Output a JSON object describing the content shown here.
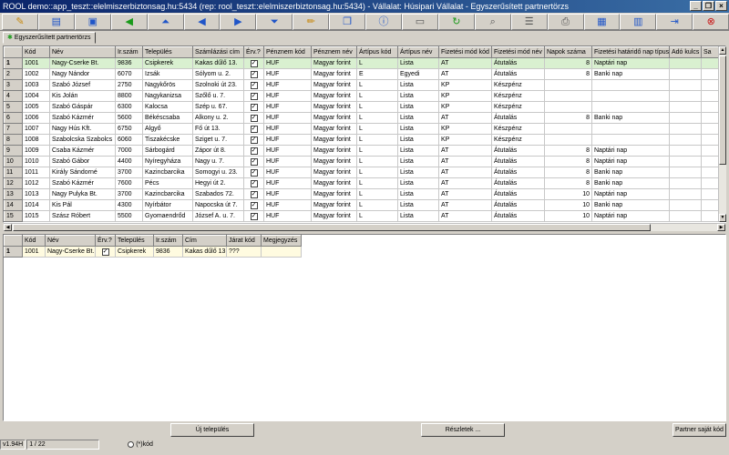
{
  "window": {
    "title": "ROOL demo::app_teszt::elelmiszerbiztonsag.hu:5434 (rep: rool_teszt::elelmiszerbiztonsag.hu:5434) - Vállalat: Húsipari Vállalat - Egyszerűsített partnertörzs",
    "min_label": "_",
    "max_label": "❐",
    "close_label": "×"
  },
  "tab": {
    "label": "Egyszerűsített partnertörzs"
  },
  "top_grid": {
    "columns": [
      "Kód",
      "Név",
      "Ir.szám",
      "Település",
      "Számlázási cím",
      "Érv.?",
      "Pénznem kód",
      "Pénznem név",
      "Ártípus kód",
      "Ártípus név",
      "Fizetési mód kód",
      "Fizetési mód név",
      "Napok száma",
      "Fizetési határidő nap típus",
      "Adó kulcs",
      "Sa"
    ],
    "rows": [
      {
        "rn": "1",
        "kod": "1001",
        "nev": "Nagy-Cserke Bt.",
        "irsz": "9836",
        "telep": "Csipkerek",
        "cim": "Kakas dűlő 13.",
        "erv": "✓",
        "pk": "HUF",
        "pn": "Magyar forint",
        "ak": "L",
        "an": "Lista",
        "fk": "AT",
        "fn": "Átutalás",
        "nap": "8",
        "tip": "Naptári nap",
        "ado": "",
        "sa": ""
      },
      {
        "rn": "2",
        "kod": "1002",
        "nev": "Nagy Nándor",
        "irsz": "6070",
        "telep": "Izsák",
        "cim": "Sólyom u. 2.",
        "erv": "✓",
        "pk": "HUF",
        "pn": "Magyar forint",
        "ak": "E",
        "an": "Egyedi",
        "fk": "AT",
        "fn": "Átutalás",
        "nap": "8",
        "tip": "Banki nap",
        "ado": "",
        "sa": ""
      },
      {
        "rn": "3",
        "kod": "1003",
        "nev": "Szabó József",
        "irsz": "2750",
        "telep": "Nagykőrös",
        "cim": "Szolnoki út 23.",
        "erv": "✓",
        "pk": "HUF",
        "pn": "Magyar forint",
        "ak": "L",
        "an": "Lista",
        "fk": "KP",
        "fn": "Készpénz",
        "nap": "",
        "tip": "",
        "ado": "",
        "sa": ""
      },
      {
        "rn": "4",
        "kod": "1004",
        "nev": "Kis Jolán",
        "irsz": "8800",
        "telep": "Nagykanizsa",
        "cim": "Szőlő u. 7.",
        "erv": "✓",
        "pk": "HUF",
        "pn": "Magyar forint",
        "ak": "L",
        "an": "Lista",
        "fk": "KP",
        "fn": "Készpénz",
        "nap": "",
        "tip": "",
        "ado": "",
        "sa": ""
      },
      {
        "rn": "5",
        "kod": "1005",
        "nev": "Szabó Gáspár",
        "irsz": "6300",
        "telep": "Kalocsa",
        "cim": "Szép u. 67.",
        "erv": "✓",
        "pk": "HUF",
        "pn": "Magyar forint",
        "ak": "L",
        "an": "Lista",
        "fk": "KP",
        "fn": "Készpénz",
        "nap": "",
        "tip": "",
        "ado": "",
        "sa": ""
      },
      {
        "rn": "6",
        "kod": "1006",
        "nev": "Szabó Kázmér",
        "irsz": "5600",
        "telep": "Békéscsaba",
        "cim": "Alkony u. 2.",
        "erv": "✓",
        "pk": "HUF",
        "pn": "Magyar forint",
        "ak": "L",
        "an": "Lista",
        "fk": "AT",
        "fn": "Átutalás",
        "nap": "8",
        "tip": "Banki nap",
        "ado": "",
        "sa": ""
      },
      {
        "rn": "7",
        "kod": "1007",
        "nev": "Nagy Hús Kft.",
        "irsz": "6750",
        "telep": "Algyő",
        "cim": "Fő út 13.",
        "erv": "✓",
        "pk": "HUF",
        "pn": "Magyar forint",
        "ak": "L",
        "an": "Lista",
        "fk": "KP",
        "fn": "Készpénz",
        "nap": "",
        "tip": "",
        "ado": "",
        "sa": ""
      },
      {
        "rn": "8",
        "kod": "1008",
        "nev": "Szabolcska Szabolcs",
        "irsz": "6060",
        "telep": "Tiszakécske",
        "cim": "Sziget u. 7.",
        "erv": "✓",
        "pk": "HUF",
        "pn": "Magyar forint",
        "ak": "L",
        "an": "Lista",
        "fk": "KP",
        "fn": "Készpénz",
        "nap": "",
        "tip": "",
        "ado": "",
        "sa": ""
      },
      {
        "rn": "9",
        "kod": "1009",
        "nev": "Csaba Kázmér",
        "irsz": "7000",
        "telep": "Sárbogárd",
        "cim": "Zápor út 8.",
        "erv": "✓",
        "pk": "HUF",
        "pn": "Magyar forint",
        "ak": "L",
        "an": "Lista",
        "fk": "AT",
        "fn": "Átutalás",
        "nap": "8",
        "tip": "Naptári nap",
        "ado": "",
        "sa": ""
      },
      {
        "rn": "10",
        "kod": "1010",
        "nev": "Szabó Gábor",
        "irsz": "4400",
        "telep": "Nyíregyháza",
        "cim": "Nagy u. 7.",
        "erv": "✓",
        "pk": "HUF",
        "pn": "Magyar forint",
        "ak": "L",
        "an": "Lista",
        "fk": "AT",
        "fn": "Átutalás",
        "nap": "8",
        "tip": "Naptári nap",
        "ado": "",
        "sa": ""
      },
      {
        "rn": "11",
        "kod": "1011",
        "nev": "Király Sándorné",
        "irsz": "3700",
        "telep": "Kazincbarcika",
        "cim": "Somogyi u. 23.",
        "erv": "✓",
        "pk": "HUF",
        "pn": "Magyar forint",
        "ak": "L",
        "an": "Lista",
        "fk": "AT",
        "fn": "Átutalás",
        "nap": "8",
        "tip": "Banki nap",
        "ado": "",
        "sa": ""
      },
      {
        "rn": "12",
        "kod": "1012",
        "nev": "Szabó Kázmér",
        "irsz": "7600",
        "telep": "Pécs",
        "cim": "Hegyi út 2.",
        "erv": "✓",
        "pk": "HUF",
        "pn": "Magyar forint",
        "ak": "L",
        "an": "Lista",
        "fk": "AT",
        "fn": "Átutalás",
        "nap": "8",
        "tip": "Banki nap",
        "ado": "",
        "sa": ""
      },
      {
        "rn": "13",
        "kod": "1013",
        "nev": "Nagy Pulyka Bt.",
        "irsz": "3700",
        "telep": "Kazincbarcika",
        "cim": "Szabados 72.",
        "erv": "✓",
        "pk": "HUF",
        "pn": "Magyar forint",
        "ak": "L",
        "an": "Lista",
        "fk": "AT",
        "fn": "Átutalás",
        "nap": "10",
        "tip": "Naptári nap",
        "ado": "",
        "sa": ""
      },
      {
        "rn": "14",
        "kod": "1014",
        "nev": "Kis Pál",
        "irsz": "4300",
        "telep": "Nyírbátor",
        "cim": "Napocska út 7.",
        "erv": "✓",
        "pk": "HUF",
        "pn": "Magyar forint",
        "ak": "L",
        "an": "Lista",
        "fk": "AT",
        "fn": "Átutalás",
        "nap": "10",
        "tip": "Banki nap",
        "ado": "",
        "sa": ""
      },
      {
        "rn": "15",
        "kod": "1015",
        "nev": "Szász Róbert",
        "irsz": "5500",
        "telep": "Gyomaendrőd",
        "cim": "József A. u. 7.",
        "erv": "✓",
        "pk": "HUF",
        "pn": "Magyar forint",
        "ak": "L",
        "an": "Lista",
        "fk": "AT",
        "fn": "Átutalás",
        "nap": "10",
        "tip": "Naptári nap",
        "ado": "",
        "sa": ""
      }
    ]
  },
  "bottom_grid": {
    "columns": [
      "Kód",
      "Név",
      "Érv.?",
      "Település",
      "Ir.szám",
      "Cím",
      "Járat kód",
      "Megjegyzés"
    ],
    "rows": [
      {
        "rn": "1",
        "kod": "1001",
        "nev": "Nagy-Cserke Bt.",
        "erv": "✓",
        "telep": "Csipkerek",
        "irsz": "9836",
        "cim": "Kakas dűlő 13.",
        "jarat": "???",
        "megj": ""
      }
    ]
  },
  "buttons": {
    "new_settlement": "Új település",
    "details": "Részletek ...",
    "partner_own_code": "Partner saját kód"
  },
  "status": {
    "version": "v1.94H",
    "position": "1 / 22",
    "kod_label": "(*)kód"
  },
  "toolbar": {
    "icons": [
      "open-folder-icon",
      "open-file-icon",
      "save-icon",
      "back-green-icon",
      "first-record-icon",
      "prev-record-icon",
      "next-record-icon",
      "last-record-icon",
      "edit-pencil-icon",
      "copy-icon",
      "info-icon",
      "form-icon",
      "refresh-icon",
      "search-icon",
      "list-icon",
      "print-icon",
      "table-icon",
      "columns-icon",
      "export-icon",
      "exit-icon"
    ]
  }
}
